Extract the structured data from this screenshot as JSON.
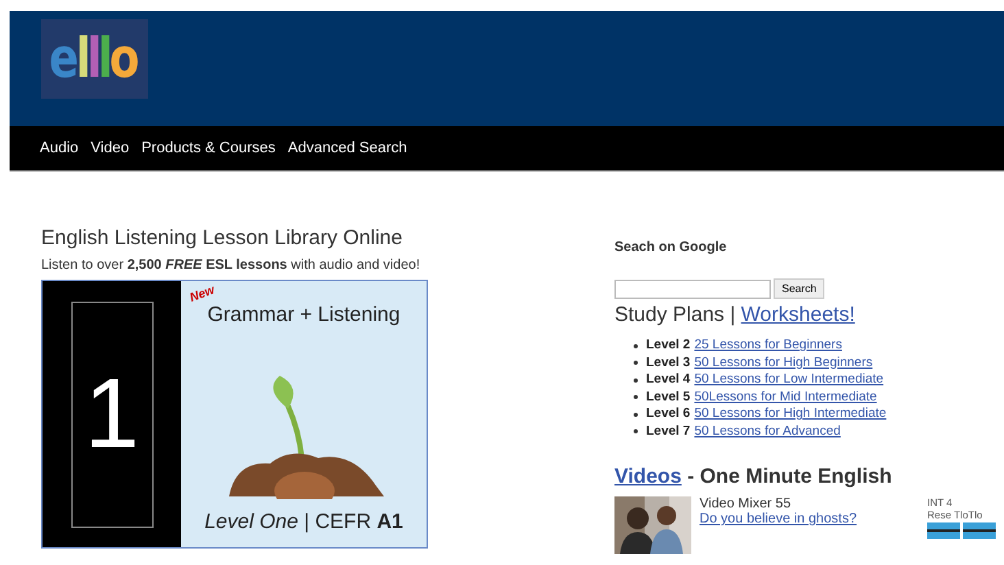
{
  "header": {
    "logo": [
      {
        "char": "e",
        "color": "#3a86c8"
      },
      {
        "char": "l",
        "color": "#d6dc7a"
      },
      {
        "char": "l",
        "color": "#b25fb5"
      },
      {
        "char": "l",
        "color": "#4cae4c"
      },
      {
        "char": "o",
        "color": "#f5a93a"
      }
    ]
  },
  "nav": [
    "Audio",
    "Video",
    "Products & Courses",
    "Advanced Search"
  ],
  "main": {
    "title": "English Listening Lesson Library Online",
    "subtitle": "Listen to over **2,500 *FREE* ESL lessons** with audio and video!",
    "banner": {
      "number": "1",
      "badge": "New",
      "heading": "Grammar + Listening",
      "caption": "*Level One* | CEFR **A1**"
    }
  },
  "sidebar": {
    "search_heading": "Seach on Google",
    "search_button": "Search",
    "study_plans": "Study Plans | ",
    "worksheets": "Worksheets!",
    "levels": [
      {
        "level": "Level 2",
        "link": "25 Lessons for Beginners"
      },
      {
        "level": "Level 3",
        "link": "50 Lessons for High Beginners"
      },
      {
        "level": "Level 4",
        "link": "50 Lessons for Low Intermediate"
      },
      {
        "level": "Level 5",
        "link": "50Lessons for Mid Intermediate"
      },
      {
        "level": "Level 6",
        "link": "50 Lessons for High Intermediate"
      },
      {
        "level": "Level 7",
        "link": "50 Lessons for Advanced"
      }
    ],
    "videos_link": "Videos",
    "videos_rest": " - One Minute English",
    "video": {
      "title": "Video Mixer 55",
      "link": "Do you believe in ghosts?"
    },
    "side_note": {
      "line1": "INT 4",
      "line2": "Rese TloTlo"
    }
  }
}
